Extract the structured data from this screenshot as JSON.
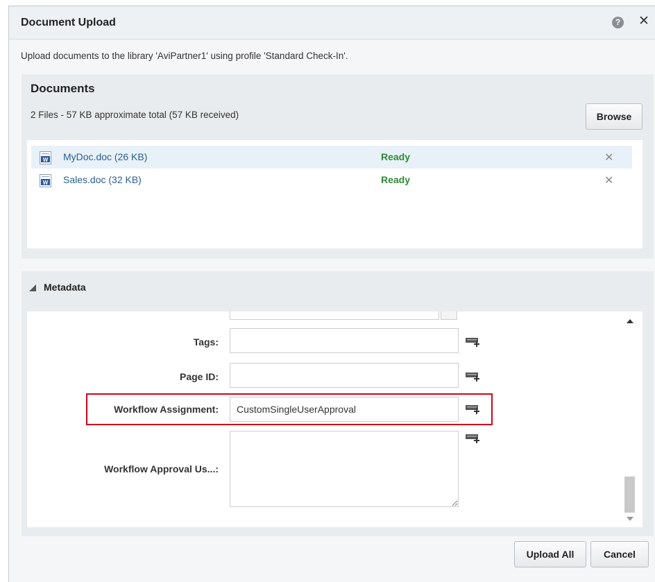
{
  "dialog": {
    "title": "Document Upload",
    "intro": "Upload documents to the library 'AviPartner1' using profile 'Standard Check-In'."
  },
  "documents": {
    "heading": "Documents",
    "summary": "2 Files  -  57 KB  approximate total   (57 KB received)",
    "browse_label": "Browse",
    "files": [
      {
        "name": "MyDoc.doc (26 KB)",
        "status": "Ready",
        "selected": true
      },
      {
        "name": "Sales.doc (32 KB)",
        "status": "Ready",
        "selected": false
      }
    ]
  },
  "metadata": {
    "heading": "Metadata",
    "fields": [
      {
        "label": "Tags:",
        "value": ""
      },
      {
        "label": "Page ID:",
        "value": ""
      },
      {
        "label": "Workflow Assignment:",
        "value": "CustomSingleUserApproval"
      },
      {
        "label": "Workflow Approval Us...:",
        "value": ""
      }
    ]
  },
  "footer": {
    "upload_label": "Upload All",
    "cancel_label": "Cancel"
  },
  "colors": {
    "ready": "#2e8b35",
    "link": "#2a5d8f",
    "highlight": "#d0021b"
  },
  "icons": {
    "help": "help-icon",
    "close": "close-icon",
    "document": "word-document-icon",
    "remove": "remove-icon",
    "add_value": "add-value-icon",
    "disclosure": "triangle-down-icon"
  }
}
